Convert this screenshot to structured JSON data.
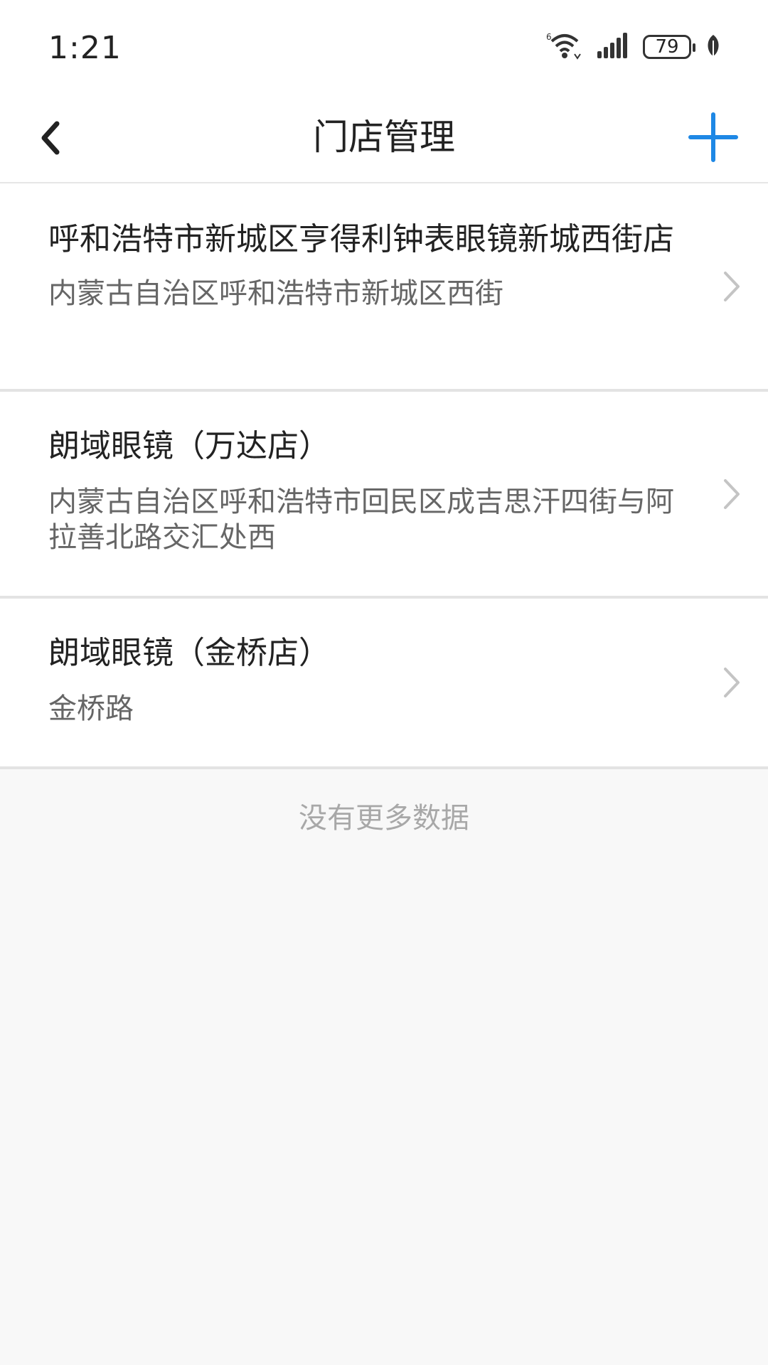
{
  "status_bar": {
    "time": "1:21",
    "battery": "79",
    "icons": [
      "wifi-6-icon",
      "signal-icon",
      "battery-icon",
      "leaf-icon"
    ]
  },
  "nav": {
    "title": "门店管理",
    "back_icon": "chevron-left-icon",
    "add_icon": "plus-icon",
    "accent_color": "#1e88e5"
  },
  "stores": [
    {
      "name": "呼和浩特市新城区亨得利钟表眼镜新城西街店",
      "address": "内蒙古自治区呼和浩特市新城区西街"
    },
    {
      "name": "朗域眼镜（万达店）",
      "address": "内蒙古自治区呼和浩特市回民区成吉思汗四街与阿拉善北路交汇处西"
    },
    {
      "name": "朗域眼镜（金桥店）",
      "address": "金桥路"
    }
  ],
  "footer": {
    "no_more_text": "没有更多数据"
  }
}
